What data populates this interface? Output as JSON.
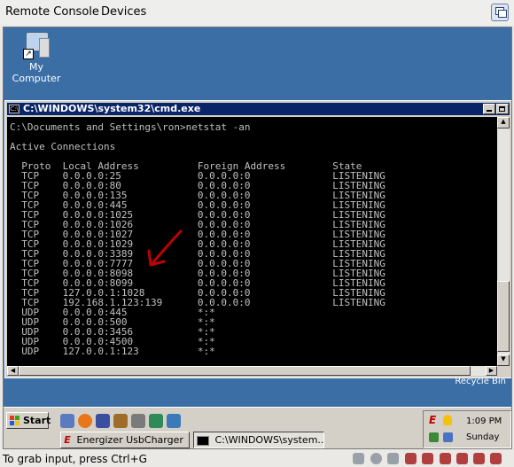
{
  "menubar": {
    "remote_console": "Remote Console",
    "devices": "Devices"
  },
  "desktop": {
    "my_computer": "My Computer",
    "recycle_bin": "Recycle Bin"
  },
  "cmd": {
    "title": "C:\\WINDOWS\\system32\\cmd.exe",
    "prompt_line": "C:\\Documents and Settings\\ron>netstat -an",
    "section": "Active Connections",
    "headers": [
      "Proto",
      "Local Address",
      "Foreign Address",
      "State"
    ],
    "rows": [
      [
        "TCP",
        "0.0.0.0:25",
        "0.0.0.0:0",
        "LISTENING"
      ],
      [
        "TCP",
        "0.0.0.0:80",
        "0.0.0.0:0",
        "LISTENING"
      ],
      [
        "TCP",
        "0.0.0.0:135",
        "0.0.0.0:0",
        "LISTENING"
      ],
      [
        "TCP",
        "0.0.0.0:445",
        "0.0.0.0:0",
        "LISTENING"
      ],
      [
        "TCP",
        "0.0.0.0:1025",
        "0.0.0.0:0",
        "LISTENING"
      ],
      [
        "TCP",
        "0.0.0.0:1026",
        "0.0.0.0:0",
        "LISTENING"
      ],
      [
        "TCP",
        "0.0.0.0:1027",
        "0.0.0.0:0",
        "LISTENING"
      ],
      [
        "TCP",
        "0.0.0.0:1029",
        "0.0.0.0:0",
        "LISTENING"
      ],
      [
        "TCP",
        "0.0.0.0:3389",
        "0.0.0.0:0",
        "LISTENING"
      ],
      [
        "TCP",
        "0.0.0.0:7777",
        "0.0.0.0:0",
        "LISTENING"
      ],
      [
        "TCP",
        "0.0.0.0:8098",
        "0.0.0.0:0",
        "LISTENING"
      ],
      [
        "TCP",
        "0.0.0.0:8099",
        "0.0.0.0:0",
        "LISTENING"
      ],
      [
        "TCP",
        "127.0.0.1:1028",
        "0.0.0.0:0",
        "LISTENING"
      ],
      [
        "TCP",
        "192.168.1.123:139",
        "0.0.0.0:0",
        "LISTENING"
      ],
      [
        "UDP",
        "0.0.0.0:445",
        "*:*",
        ""
      ],
      [
        "UDP",
        "0.0.0.0:500",
        "*:*",
        ""
      ],
      [
        "UDP",
        "0.0.0.0:3456",
        "*:*",
        ""
      ],
      [
        "UDP",
        "0.0.0.0:4500",
        "*:*",
        ""
      ],
      [
        "UDP",
        "127.0.0.1:123",
        "*:*",
        ""
      ]
    ],
    "colors": {
      "titlebar": "#0a246a",
      "console_bg": "#000000",
      "console_fg": "#c0c0c0"
    }
  },
  "annotation": {
    "color": "#c00000",
    "icon": "hand-drawn-arrow-pointing-to-port-3389"
  },
  "taskbar": {
    "start": "Start",
    "quicklaunch_icons": [
      "show-desktop-icon",
      "firefox-icon",
      "app-icon",
      "window-switch-icon",
      "app-icon",
      "app-icon",
      "app-icon"
    ],
    "buttons": [
      "Energizer UsbCharger",
      "C:\\WINDOWS\\system..."
    ],
    "time": "1:09 PM",
    "day": "Sunday"
  },
  "status": {
    "hint": "To grab input, press Ctrl+G"
  }
}
